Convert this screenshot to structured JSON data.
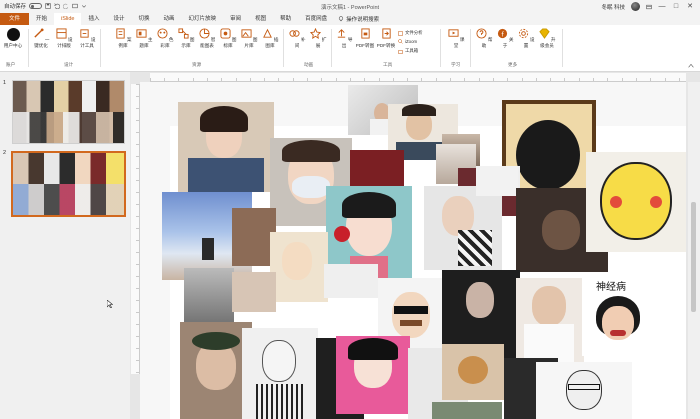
{
  "titlebar": {
    "autosave_label": "自动保存",
    "toggle_state": "关",
    "title": "演示文稿1 - PowerPoint",
    "user": "冬眠 科技",
    "window_buttons": [
      "—",
      "□",
      "✕"
    ]
  },
  "tabs": {
    "file": "文件",
    "items": [
      "开始",
      "iSlide",
      "插入",
      "设计",
      "切换",
      "动画",
      "幻灯片放映",
      "审阅",
      "视图",
      "帮助",
      "百度网盘"
    ],
    "active": "iSlide",
    "search": "操作说明搜索"
  },
  "ribbon": {
    "groups": [
      {
        "label": "账户",
        "buttons": [
          "ID",
          "用户中心"
        ]
      },
      {
        "label": "设计",
        "buttons": [
          "一键优化",
          "设计排版",
          "设计工具"
        ]
      },
      {
        "label": "资源",
        "buttons": [
          "案例库",
          "主题库",
          "色彩库",
          "图示库",
          "智能图表",
          "图标库",
          "图片库",
          "插图库"
        ]
      },
      {
        "label": "动画",
        "buttons": [
          "补间",
          "扩展"
        ]
      },
      {
        "label": "工具",
        "buttons": [
          "导出",
          "PDF转图",
          "PDF转换"
        ],
        "small": [
          "文件分析",
          "iZoom",
          "工具箱"
        ]
      },
      {
        "label": "学习",
        "buttons": [
          "课堂"
        ]
      },
      {
        "label": "更多",
        "buttons": [
          "帮助",
          "关于",
          "设置",
          "升级会员"
        ]
      }
    ]
  },
  "ruler": {
    "labels": [
      "10",
      "9",
      "8",
      "7",
      "6",
      "5",
      "4",
      "3",
      "2",
      "1",
      "0",
      "1",
      "2",
      "3",
      "4",
      "5",
      "6",
      "7",
      "8",
      "9",
      "10",
      "11",
      "12",
      "13",
      "14",
      "15",
      "16",
      "17",
      "18",
      "19",
      "20",
      "21",
      "22",
      "23",
      "24",
      "25",
      "26"
    ]
  },
  "slides": [
    {
      "number": "1"
    },
    {
      "number": "2",
      "selected": true
    }
  ],
  "canvas": {
    "caption": "神经病"
  },
  "colors": {
    "accent": "#c55a11",
    "selection": "#d2691e"
  }
}
